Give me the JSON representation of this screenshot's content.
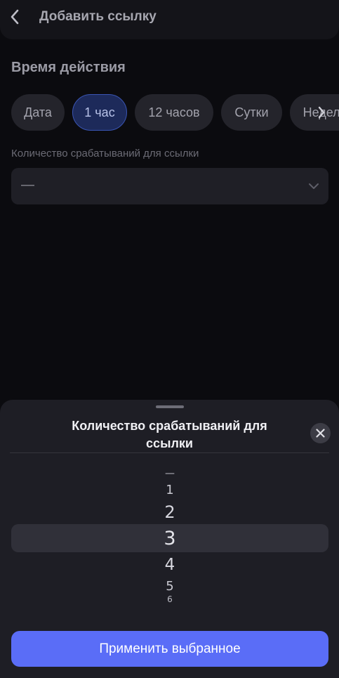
{
  "header": {
    "title": "Добавить ссылку",
    "back_icon": "chevron-left-icon"
  },
  "validity": {
    "section_title": "Время действия",
    "options": [
      {
        "label": "Дата",
        "selected": false
      },
      {
        "label": "1 час",
        "selected": true
      },
      {
        "label": "12 часов",
        "selected": false
      },
      {
        "label": "Сутки",
        "selected": false
      },
      {
        "label": "Неделя",
        "selected": false
      }
    ],
    "scroll_icon": "chevron-right-icon"
  },
  "trigger_count": {
    "label": "Количество срабатываний для ссылки",
    "value": "—",
    "dropdown_icon": "chevron-down-icon"
  },
  "sheet": {
    "title": "Количество срабатываний для ссылки",
    "close_icon": "close-icon",
    "picker_items": [
      "—",
      "1",
      "2",
      "3",
      "4",
      "5",
      "6"
    ],
    "selected_value": "3",
    "apply_label": "Применить выбранное"
  },
  "colors": {
    "accent": "#5a6df7",
    "chip_active": "#1d2a5a",
    "background": "#0b0b0f",
    "sheet": "#1e1e25"
  }
}
